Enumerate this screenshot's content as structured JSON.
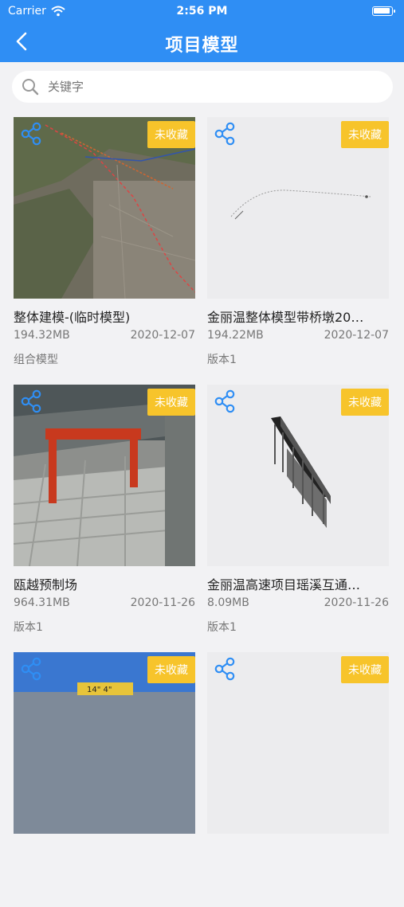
{
  "status": {
    "carrier": "Carrier",
    "time": "2:56 PM"
  },
  "nav": {
    "title": "项目模型"
  },
  "search": {
    "placeholder": "关键字"
  },
  "badge_label": "未收藏",
  "cards": [
    {
      "name": "整体建模-(临时模型)",
      "size": "194.32MB",
      "date": "2020-12-07",
      "version": "组合模型"
    },
    {
      "name": "金丽温整体模型带桥墩20…",
      "size": "194.22MB",
      "date": "2020-12-07",
      "version": "版本1"
    },
    {
      "name": "瓯越预制场",
      "size": "964.31MB",
      "date": "2020-11-26",
      "version": "版本1"
    },
    {
      "name": "金丽温高速项目瑶溪互通…",
      "size": "8.09MB",
      "date": "2020-11-26",
      "version": "版本1"
    },
    {
      "name": "",
      "size": "",
      "date": "",
      "version": ""
    },
    {
      "name": "",
      "size": "",
      "date": "",
      "version": ""
    }
  ],
  "colors": {
    "primary": "#2f8ef4",
    "badge": "#f7c42b",
    "background": "#f2f2f4"
  }
}
